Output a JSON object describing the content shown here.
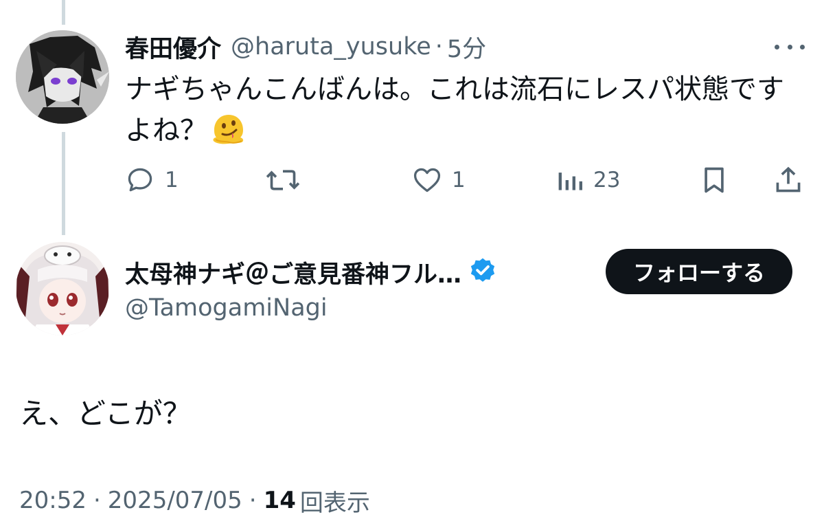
{
  "reply_tweet": {
    "author_name": "春田優介",
    "author_handle": "@haruta_yusuke",
    "separator": "·",
    "time": "5分",
    "text": "ナギちゃんこんばんは。これは流石にレスパ状態ですよね？",
    "emoji": "melting-face",
    "actions": {
      "replies": "1",
      "likes": "1",
      "views": "23"
    }
  },
  "main_tweet": {
    "author_name": "太母神ナギ＠ご意見番神フル…",
    "author_handle": "@TamogamiNagi",
    "verified": true,
    "follow_label": "フォローする",
    "text": "え、どこが？",
    "time": "20:52",
    "date": "2025/07/05",
    "separator": "·",
    "view_count": "14",
    "view_label": "回表示"
  },
  "colors": {
    "text_primary": "#0f1419",
    "text_secondary": "#536471",
    "verified_blue": "#1d9bf0",
    "follow_bg": "#0f1419",
    "thread_line": "#cfd9de"
  }
}
